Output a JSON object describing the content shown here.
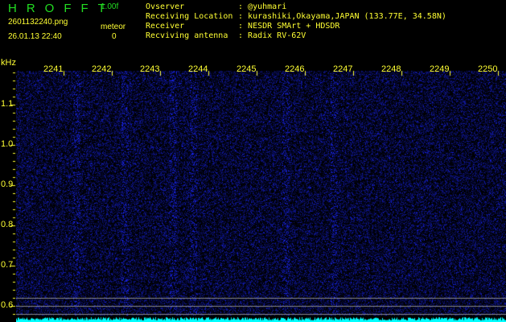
{
  "app": {
    "logo": "HROFFT",
    "version": "1.00f"
  },
  "file": {
    "name": "2601132240.png",
    "datetime": "26.01.13 22:40"
  },
  "meteor": {
    "label": "meteor",
    "count": "0"
  },
  "info": [
    {
      "label": "Ovserver",
      "value": "@yuhmari"
    },
    {
      "label": "Receiving Location",
      "value": "kurashiki,Okayama,JAPAN (133.77E, 34.58N)"
    },
    {
      "label": "Receiver",
      "value": "NESDR SMArt + HDSDR"
    },
    {
      "label": "Recviving antenna",
      "value": "Radix RV-62V"
    }
  ],
  "axes": {
    "y_unit": "kHz",
    "x_ticks": [
      "2241",
      "2242",
      "2243",
      "2244",
      "2245",
      "2246",
      "2247",
      "2248",
      "2249",
      "2250"
    ],
    "y_ticks": [
      "1.1",
      "1.0",
      "0.9",
      "0.8",
      "0.7",
      "0.6"
    ]
  },
  "colors": {
    "text": "#ffff33",
    "logo": "#22dd22",
    "signal": "#2233ff",
    "level": "#00ffff"
  }
}
